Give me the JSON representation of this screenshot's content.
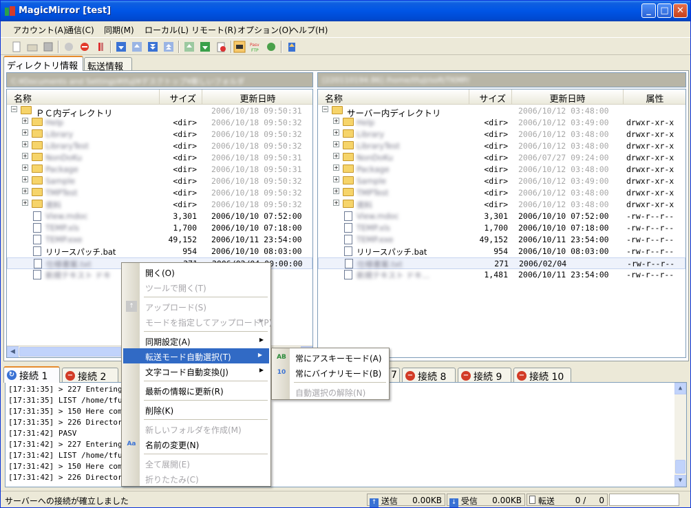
{
  "app": {
    "title": "MagicMirror [test]"
  },
  "menu": [
    "アカウント(A)",
    "通信(C)",
    "同期(M)",
    "ローカル(L)",
    "リモート(R)",
    "オプション(O)",
    "ヘルプ(H)"
  ],
  "top_tabs": [
    "ディレクトリ情報",
    "転送情報"
  ],
  "left": {
    "path": "C:¥Documents and Settings¥tfuji¥デスクトップ¥新しいフォルダ",
    "columns": [
      "名称",
      "サイズ",
      "更新日時"
    ],
    "root": "ＰＣ内ディレクトリ",
    "root_date": "2006/10/18 09:50:31",
    "rows": [
      {
        "name": "Help",
        "size": "<dir>",
        "date": "2006/10/18 09:50:32"
      },
      {
        "name": "Library",
        "size": "<dir>",
        "date": "2006/10/18 09:50:32"
      },
      {
        "name": "LibraryTest",
        "size": "<dir>",
        "date": "2006/10/18 09:50:32"
      },
      {
        "name": "NonDoKu",
        "size": "<dir>",
        "date": "2006/10/18 09:50:31"
      },
      {
        "name": "Package",
        "size": "<dir>",
        "date": "2006/10/18 09:50:31"
      },
      {
        "name": "Sample",
        "size": "<dir>",
        "date": "2006/10/18 09:50:32"
      },
      {
        "name": "TMPTest",
        "size": "<dir>",
        "date": "2006/10/18 09:50:32"
      },
      {
        "name": "資料",
        "size": "<dir>",
        "date": "2006/10/18 09:50:32"
      },
      {
        "name": "View.mdoc",
        "size": "3,301",
        "date": "2006/10/10 07:52:00"
      },
      {
        "name": "TEMP.xls",
        "size": "1,700",
        "date": "2006/10/10 07:18:00"
      },
      {
        "name": "TEMP.exe",
        "size": "49,152",
        "date": "2006/10/11 23:54:00"
      },
      {
        "name": "リリースパッチ.bat",
        "size": "954",
        "date": "2006/10/10 08:03:00"
      },
      {
        "name": "仕様書案.txt",
        "size": "271",
        "date": "2006/02/04 00:00:00"
      },
      {
        "name": "新規テキスト ドキ",
        "size": "",
        "date": ":54:00"
      }
    ]
  },
  "right": {
    "path": "[220110194.86] /home/tfuji/soft/TKMP/",
    "columns": [
      "名称",
      "サイズ",
      "更新日時",
      "属性"
    ],
    "root": "サーバー内ディレクトリ",
    "root_date": "2006/10/12 03:48:00",
    "rows": [
      {
        "name": "Help",
        "size": "<dir>",
        "date": "2006/10/12 03:49:00",
        "attr": "drwxr-xr-x"
      },
      {
        "name": "Library",
        "size": "<dir>",
        "date": "2006/10/12 03:48:00",
        "attr": "drwxr-xr-x"
      },
      {
        "name": "LibraryTest",
        "size": "<dir>",
        "date": "2006/10/12 03:48:00",
        "attr": "drwxr-xr-x"
      },
      {
        "name": "NonDoKu",
        "size": "<dir>",
        "date": "2006/07/27 09:24:00",
        "attr": "drwxr-xr-x"
      },
      {
        "name": "Package",
        "size": "<dir>",
        "date": "2006/10/12 03:48:00",
        "attr": "drwxr-xr-x"
      },
      {
        "name": "Sample",
        "size": "<dir>",
        "date": "2006/10/12 03:49:00",
        "attr": "drwxr-xr-x"
      },
      {
        "name": "TMPTest",
        "size": "<dir>",
        "date": "2006/10/12 03:48:00",
        "attr": "drwxr-xr-x"
      },
      {
        "name": "資料",
        "size": "<dir>",
        "date": "2006/10/12 03:48:00",
        "attr": "drwxr-xr-x"
      },
      {
        "name": "View.mdoc",
        "size": "3,301",
        "date": "2006/10/10 07:52:00",
        "attr": "-rw-r--r--"
      },
      {
        "name": "TEMP.xls",
        "size": "1,700",
        "date": "2006/10/10 07:18:00",
        "attr": "-rw-r--r--"
      },
      {
        "name": "TEMP.exe",
        "size": "49,152",
        "date": "2006/10/11 23:54:00",
        "attr": "-rw-r--r--"
      },
      {
        "name": "リリースパッチ.bat",
        "size": "954",
        "date": "2006/10/10 08:03:00",
        "attr": "-rw-r--r--"
      },
      {
        "name": "仕様書案.txt",
        "size": "271",
        "date": "2006/02/04",
        "attr": "-rw-r--r--"
      },
      {
        "name": "新規テキスト ドキ...",
        "size": "1,481",
        "date": "2006/10/11 23:54:00",
        "attr": "-rw-r--r--"
      }
    ]
  },
  "conn_tabs": [
    {
      "label": "接続",
      "num": "1"
    },
    {
      "label": "接続",
      "num": "2"
    },
    {
      "label": "",
      "num": "7"
    },
    {
      "label": "接続",
      "num": "8"
    },
    {
      "label": "接続",
      "num": "9"
    },
    {
      "label": "接続",
      "num": "10"
    }
  ],
  "log": [
    "[17:31:35] > 227 Entering Pa",
    "[17:31:35] LIST /home/tfuji",
    "[17:31:35] > 150 Here comes",
    "[17:31:35] > 226 Directory s",
    "[17:31:42] PASV",
    "[17:31:42] > 227 Entering Pa",
    "[17:31:42] LIST /home/tfuji",
    "[17:31:42] > 150 Here comes",
    "[17:31:42] > 226 Directory s"
  ],
  "status": {
    "message": "サーバーへの接続が確立しました",
    "send_label": "送信",
    "send_value": "0.00KB",
    "recv_label": "受信",
    "recv_value": "0.00KB",
    "transfer_label": "転送",
    "transfer_value": "0 /     0"
  },
  "context_menu": [
    {
      "label": "開く(O)",
      "disabled": false
    },
    {
      "label": "ツールで開く(T)",
      "disabled": true
    },
    {
      "label": "アップロード(S)",
      "disabled": true
    },
    {
      "label": "モードを指定してアップロード(P)",
      "disabled": true,
      "submenu": true
    },
    {
      "label": "同期設定(A)",
      "disabled": false,
      "submenu": true
    },
    {
      "label": "転送モード自動選択(T)",
      "disabled": false,
      "submenu": true,
      "highlight": true
    },
    {
      "label": "文字コード自動変換(J)",
      "disabled": false,
      "submenu": true
    },
    {
      "label": "最新の情報に更新(R)",
      "disabled": false
    },
    {
      "label": "削除(K)",
      "disabled": false
    },
    {
      "label": "新しいフォルダを作成(M)",
      "disabled": true
    },
    {
      "label": "名前の変更(N)",
      "disabled": false
    },
    {
      "label": "全て展開(E)",
      "disabled": true
    },
    {
      "label": "折りたたみ(C)",
      "disabled": true
    }
  ],
  "submenu": [
    {
      "label": "常にアスキーモード(A)",
      "disabled": false
    },
    {
      "label": "常にバイナリモード(B)",
      "disabled": false
    },
    {
      "label": "自動選択の解除(N)",
      "disabled": true
    }
  ]
}
